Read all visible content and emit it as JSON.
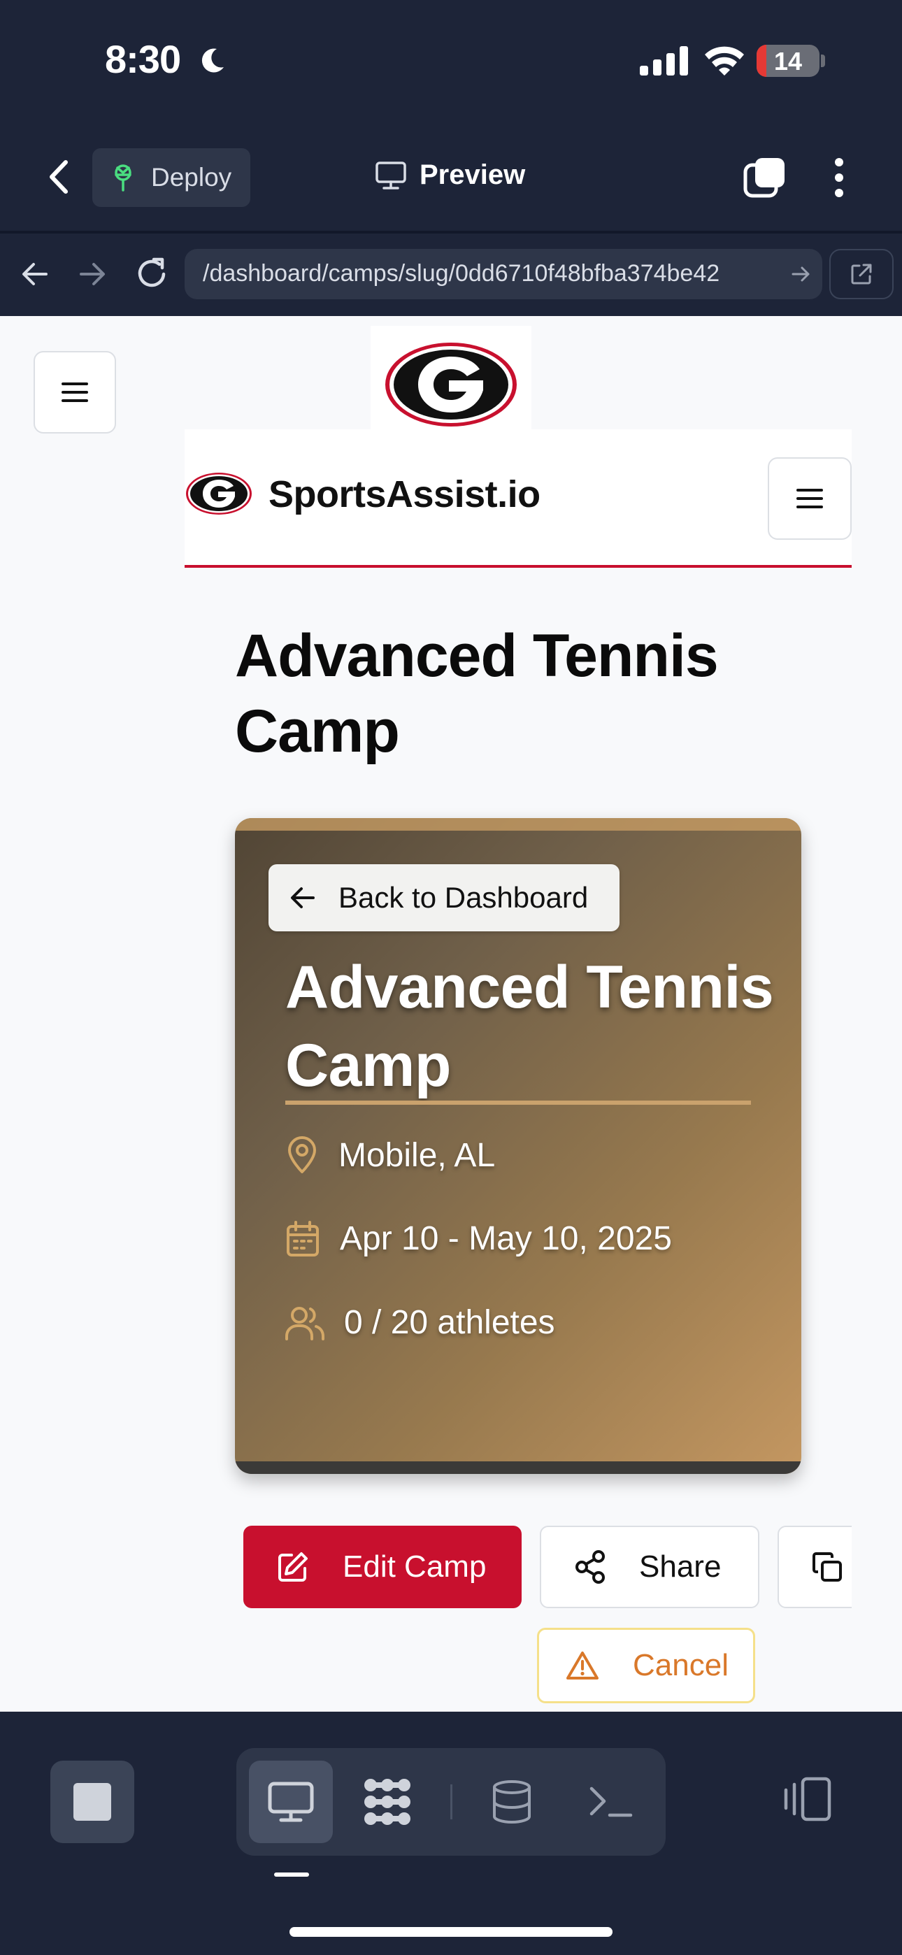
{
  "status_bar": {
    "time": "8:30",
    "battery": "14",
    "icons": [
      "moon-icon",
      "cellular-signal-icon",
      "wifi-icon",
      "battery-icon"
    ]
  },
  "app_bar": {
    "deploy_label": "Deploy",
    "preview_label": "Preview",
    "icons": [
      "chevron-left-icon",
      "deploy-icon",
      "monitor-icon",
      "tabs-icon",
      "more-vertical-icon"
    ]
  },
  "browser": {
    "url": "/dashboard/camps/slug/0dd6710f48bfba374be42",
    "icons": [
      "arrow-left-icon",
      "arrow-right-icon",
      "reload-icon",
      "arrow-go-icon",
      "external-link-icon"
    ]
  },
  "site": {
    "brand_name": "SportsAssist.io",
    "page_title": "Advanced Tennis Camp",
    "logo": "georgia-g-logo",
    "colors": {
      "brand_red": "#c8102e",
      "gold": "#c49761",
      "warning": "#d9782a"
    }
  },
  "camp": {
    "back_label": "Back to Dashboard",
    "title": "Advanced Tennis Camp",
    "location": "Mobile, AL",
    "dates": "Apr 10 - May 10, 2025",
    "athletes": "0 / 20 athletes"
  },
  "actions": {
    "edit_label": "Edit Camp",
    "share_label": "Share",
    "cancel_label": "Cancel"
  },
  "bottom_bar": {
    "tools": [
      "stop-icon",
      "monitor-icon",
      "apps-icon",
      "database-icon",
      "terminal-icon",
      "panel-layout-icon"
    ]
  }
}
